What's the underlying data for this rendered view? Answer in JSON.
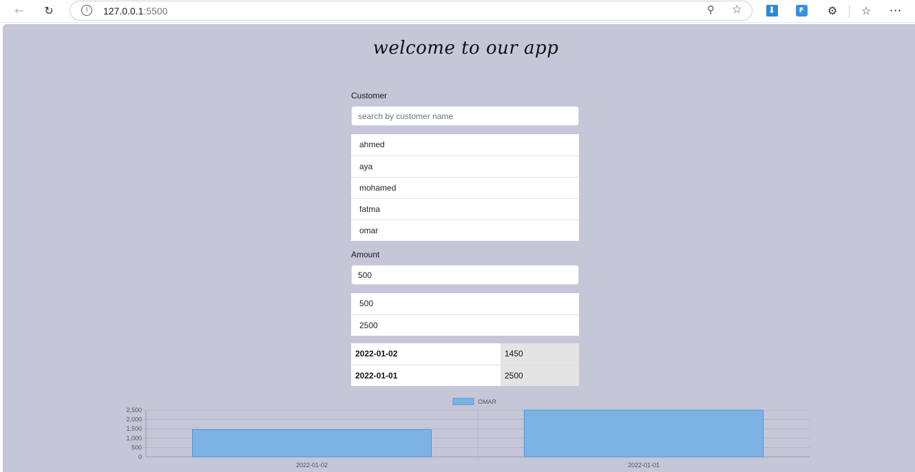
{
  "browser": {
    "url_host": "127.0.0.1",
    "url_port": ":5500",
    "icons": [
      "back-arrow-icon",
      "reload-icon",
      "info-icon",
      "zoom-out-icon",
      "favorite-star-icon",
      "download-extension-icon",
      "translate-extension-icon",
      "extensions-puzzle-icon",
      "favorites-list-icon",
      "more-options-icon"
    ]
  },
  "page": {
    "title": "welcome to our app",
    "customer_label": "Customer",
    "customer_search": {
      "placeholder": "search by customer name",
      "value": ""
    },
    "customers": [
      "ahmed",
      "aya",
      "mohamed",
      "fatma",
      "omar"
    ],
    "amount_label": "Amount",
    "amount_input": {
      "value": "500"
    },
    "amounts": [
      "500",
      "2500"
    ],
    "transactions": [
      {
        "date": "2022-01-02",
        "amount": "1450"
      },
      {
        "date": "2022-01-01",
        "amount": "2500"
      }
    ]
  },
  "colors": {
    "page_bg": "#c6c6d9",
    "bar_fill": "#7db3e3",
    "bar_border": "#4a96d9"
  },
  "chart_data": {
    "type": "bar",
    "categories": [
      "2022-01-02",
      "2022-01-01"
    ],
    "series": [
      {
        "name": "OMAR",
        "values": [
          1450,
          2500
        ]
      }
    ],
    "yticks": [
      "0",
      "500",
      "1,000",
      "1,500",
      "2,000",
      "2,500"
    ],
    "ylim": [
      0,
      2500
    ],
    "grid": true,
    "legend": "top-center",
    "xlabel": "",
    "ylabel": ""
  }
}
